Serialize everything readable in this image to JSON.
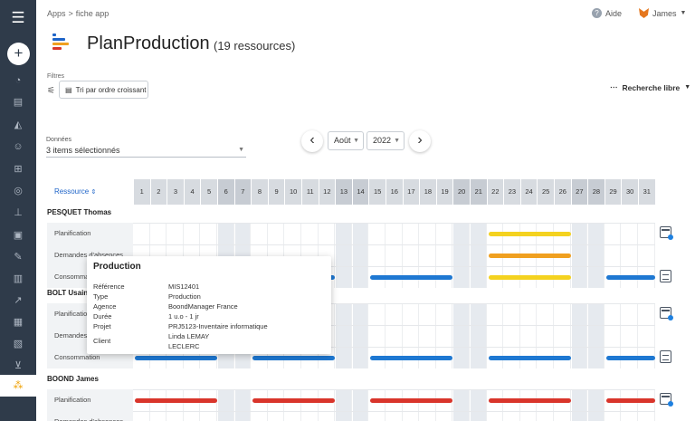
{
  "breadcrumb": {
    "apps": "Apps",
    "separator": ">",
    "current": "fiche app"
  },
  "header": {
    "help_label": "Aide",
    "user_name": "James"
  },
  "page": {
    "title": "PlanProduction",
    "count": "(19 ressources)"
  },
  "filters": {
    "label": "Filtres",
    "sort_label": "Tri par ordre croissant",
    "free_search_label": "Recherche libre"
  },
  "data_filter": {
    "label": "Données",
    "value": "3 items sélectionnés"
  },
  "period": {
    "month": "Août",
    "year": "2022"
  },
  "grid": {
    "resource_header": "Ressource",
    "days": [
      "1",
      "2",
      "3",
      "4",
      "5",
      "6",
      "7",
      "8",
      "9",
      "10",
      "11",
      "12",
      "13",
      "14",
      "15",
      "16",
      "17",
      "18",
      "19",
      "20",
      "21",
      "22",
      "23",
      "24",
      "25",
      "26",
      "27",
      "28",
      "29",
      "30",
      "31"
    ],
    "weekend_days": [
      6,
      7,
      13,
      14,
      20,
      21,
      27,
      28
    ],
    "persons": [
      {
        "name": "PESQUET Thomas",
        "rows": [
          "Planification",
          "Demandes d'absences",
          "Consommation"
        ]
      },
      {
        "name": "BOLT Usain",
        "rows": [
          "Planification",
          "Demandes d'absences",
          "Consommation"
        ]
      },
      {
        "name": "BOOND James",
        "rows": [
          "Planification",
          "Demandes d'absences"
        ]
      }
    ]
  },
  "tooltip": {
    "title": "Production",
    "fields": [
      {
        "key": "Référence",
        "value": "MIS12401"
      },
      {
        "key": "Type",
        "value": "Production"
      },
      {
        "key": "Agence",
        "value": "BoondManager France"
      },
      {
        "key": "Durée",
        "value": "1 u.o - 1 jr"
      },
      {
        "key": "Projet",
        "value": "PRJ5123-Inventaire informatique"
      },
      {
        "key": "Client",
        "value": "Linda LEMAY"
      },
      {
        "key": "",
        "value": "LECLERC"
      }
    ]
  },
  "colors": {
    "planification": "#f4d21f",
    "absences": "#f0a020",
    "consommation": "#1e78d2",
    "planification_boond": "#d9352b",
    "sidebar": "#2f3b4a"
  },
  "sidebar_icons": [
    "menu-icon",
    "add-icon",
    "dashboard-icon",
    "tasks-icon",
    "academy-icon",
    "contacts-icon",
    "org-icon",
    "target-icon",
    "pin-icon",
    "briefcase-icon",
    "edit-icon",
    "documents-icon",
    "chart-icon",
    "invoice-icon",
    "receipt-icon",
    "cart-icon",
    "apps-icon"
  ]
}
